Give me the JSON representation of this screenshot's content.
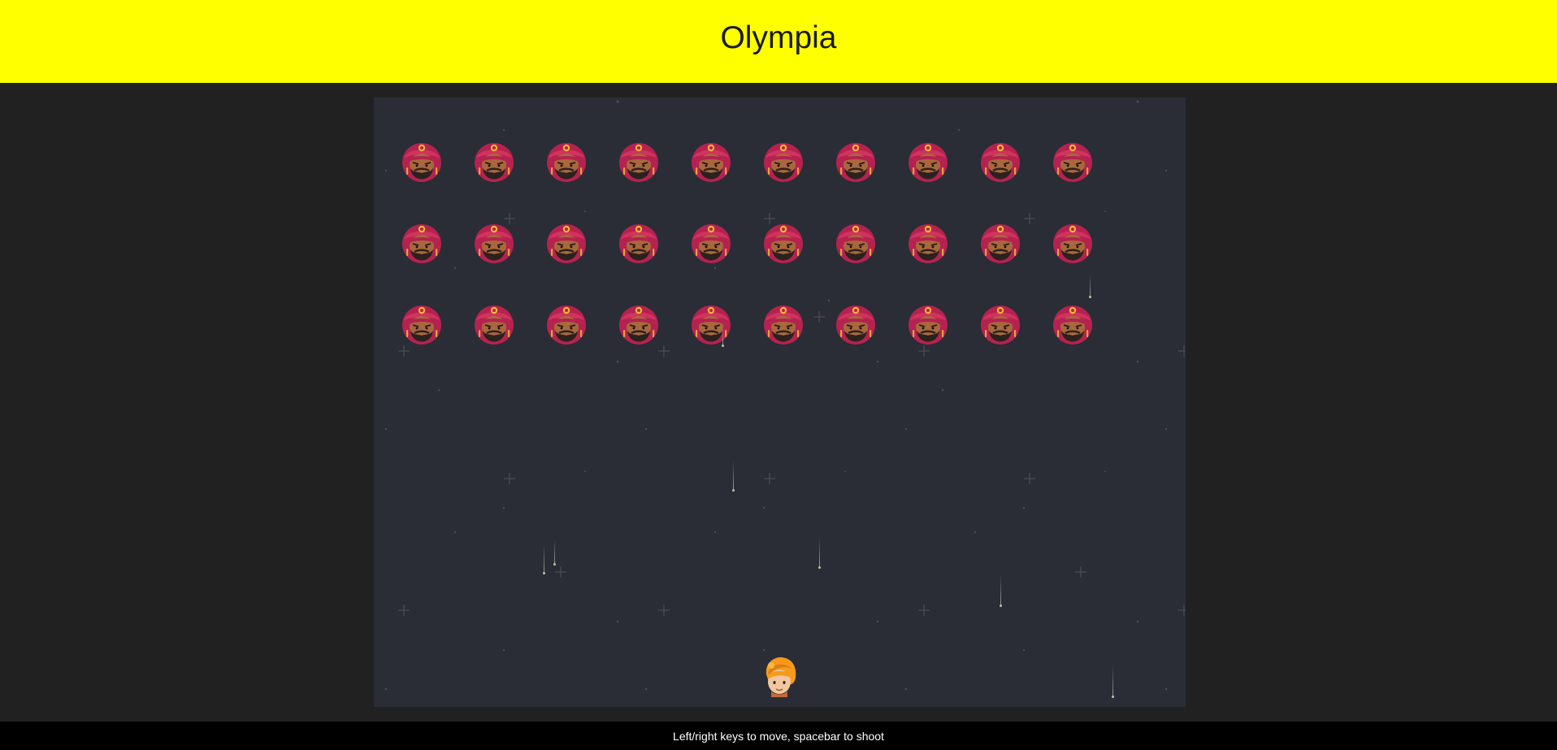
{
  "colors": {
    "header_bg": "#ffff00",
    "page_bg": "#212121",
    "stage_bg": "#2a2d35",
    "footer_bg": "#000000",
    "enemy_turban": "#b5224f",
    "player_turban": "#f59a1b"
  },
  "header": {
    "title": "Olympia"
  },
  "game": {
    "enemy_rows": 3,
    "enemy_cols": 10,
    "enemy_icon": "turbaned-bearded-face-icon",
    "player_icon": "turbaned-boy-face-icon",
    "bullet_icon": "falling-bullet-trail"
  },
  "footer": {
    "instructions": "Left/right keys to move, spacebar to shoot"
  }
}
